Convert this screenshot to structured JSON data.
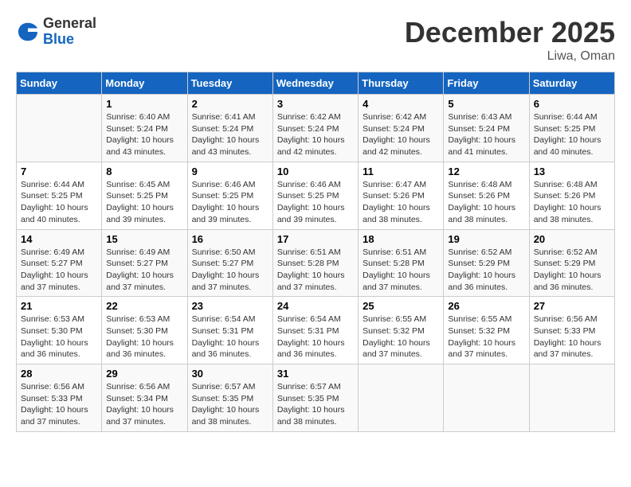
{
  "header": {
    "logo_general": "General",
    "logo_blue": "Blue",
    "month_title": "December 2025",
    "location": "Liwa, Oman"
  },
  "days_of_week": [
    "Sunday",
    "Monday",
    "Tuesday",
    "Wednesday",
    "Thursday",
    "Friday",
    "Saturday"
  ],
  "weeks": [
    [
      {
        "day": "",
        "sunrise": "",
        "sunset": "",
        "daylight": ""
      },
      {
        "day": "1",
        "sunrise": "Sunrise: 6:40 AM",
        "sunset": "Sunset: 5:24 PM",
        "daylight": "Daylight: 10 hours and 43 minutes."
      },
      {
        "day": "2",
        "sunrise": "Sunrise: 6:41 AM",
        "sunset": "Sunset: 5:24 PM",
        "daylight": "Daylight: 10 hours and 43 minutes."
      },
      {
        "day": "3",
        "sunrise": "Sunrise: 6:42 AM",
        "sunset": "Sunset: 5:24 PM",
        "daylight": "Daylight: 10 hours and 42 minutes."
      },
      {
        "day": "4",
        "sunrise": "Sunrise: 6:42 AM",
        "sunset": "Sunset: 5:24 PM",
        "daylight": "Daylight: 10 hours and 42 minutes."
      },
      {
        "day": "5",
        "sunrise": "Sunrise: 6:43 AM",
        "sunset": "Sunset: 5:24 PM",
        "daylight": "Daylight: 10 hours and 41 minutes."
      },
      {
        "day": "6",
        "sunrise": "Sunrise: 6:44 AM",
        "sunset": "Sunset: 5:25 PM",
        "daylight": "Daylight: 10 hours and 40 minutes."
      }
    ],
    [
      {
        "day": "7",
        "sunrise": "Sunrise: 6:44 AM",
        "sunset": "Sunset: 5:25 PM",
        "daylight": "Daylight: 10 hours and 40 minutes."
      },
      {
        "day": "8",
        "sunrise": "Sunrise: 6:45 AM",
        "sunset": "Sunset: 5:25 PM",
        "daylight": "Daylight: 10 hours and 39 minutes."
      },
      {
        "day": "9",
        "sunrise": "Sunrise: 6:46 AM",
        "sunset": "Sunset: 5:25 PM",
        "daylight": "Daylight: 10 hours and 39 minutes."
      },
      {
        "day": "10",
        "sunrise": "Sunrise: 6:46 AM",
        "sunset": "Sunset: 5:25 PM",
        "daylight": "Daylight: 10 hours and 39 minutes."
      },
      {
        "day": "11",
        "sunrise": "Sunrise: 6:47 AM",
        "sunset": "Sunset: 5:26 PM",
        "daylight": "Daylight: 10 hours and 38 minutes."
      },
      {
        "day": "12",
        "sunrise": "Sunrise: 6:48 AM",
        "sunset": "Sunset: 5:26 PM",
        "daylight": "Daylight: 10 hours and 38 minutes."
      },
      {
        "day": "13",
        "sunrise": "Sunrise: 6:48 AM",
        "sunset": "Sunset: 5:26 PM",
        "daylight": "Daylight: 10 hours and 38 minutes."
      }
    ],
    [
      {
        "day": "14",
        "sunrise": "Sunrise: 6:49 AM",
        "sunset": "Sunset: 5:27 PM",
        "daylight": "Daylight: 10 hours and 37 minutes."
      },
      {
        "day": "15",
        "sunrise": "Sunrise: 6:49 AM",
        "sunset": "Sunset: 5:27 PM",
        "daylight": "Daylight: 10 hours and 37 minutes."
      },
      {
        "day": "16",
        "sunrise": "Sunrise: 6:50 AM",
        "sunset": "Sunset: 5:27 PM",
        "daylight": "Daylight: 10 hours and 37 minutes."
      },
      {
        "day": "17",
        "sunrise": "Sunrise: 6:51 AM",
        "sunset": "Sunset: 5:28 PM",
        "daylight": "Daylight: 10 hours and 37 minutes."
      },
      {
        "day": "18",
        "sunrise": "Sunrise: 6:51 AM",
        "sunset": "Sunset: 5:28 PM",
        "daylight": "Daylight: 10 hours and 37 minutes."
      },
      {
        "day": "19",
        "sunrise": "Sunrise: 6:52 AM",
        "sunset": "Sunset: 5:29 PM",
        "daylight": "Daylight: 10 hours and 36 minutes."
      },
      {
        "day": "20",
        "sunrise": "Sunrise: 6:52 AM",
        "sunset": "Sunset: 5:29 PM",
        "daylight": "Daylight: 10 hours and 36 minutes."
      }
    ],
    [
      {
        "day": "21",
        "sunrise": "Sunrise: 6:53 AM",
        "sunset": "Sunset: 5:30 PM",
        "daylight": "Daylight: 10 hours and 36 minutes."
      },
      {
        "day": "22",
        "sunrise": "Sunrise: 6:53 AM",
        "sunset": "Sunset: 5:30 PM",
        "daylight": "Daylight: 10 hours and 36 minutes."
      },
      {
        "day": "23",
        "sunrise": "Sunrise: 6:54 AM",
        "sunset": "Sunset: 5:31 PM",
        "daylight": "Daylight: 10 hours and 36 minutes."
      },
      {
        "day": "24",
        "sunrise": "Sunrise: 6:54 AM",
        "sunset": "Sunset: 5:31 PM",
        "daylight": "Daylight: 10 hours and 36 minutes."
      },
      {
        "day": "25",
        "sunrise": "Sunrise: 6:55 AM",
        "sunset": "Sunset: 5:32 PM",
        "daylight": "Daylight: 10 hours and 37 minutes."
      },
      {
        "day": "26",
        "sunrise": "Sunrise: 6:55 AM",
        "sunset": "Sunset: 5:32 PM",
        "daylight": "Daylight: 10 hours and 37 minutes."
      },
      {
        "day": "27",
        "sunrise": "Sunrise: 6:56 AM",
        "sunset": "Sunset: 5:33 PM",
        "daylight": "Daylight: 10 hours and 37 minutes."
      }
    ],
    [
      {
        "day": "28",
        "sunrise": "Sunrise: 6:56 AM",
        "sunset": "Sunset: 5:33 PM",
        "daylight": "Daylight: 10 hours and 37 minutes."
      },
      {
        "day": "29",
        "sunrise": "Sunrise: 6:56 AM",
        "sunset": "Sunset: 5:34 PM",
        "daylight": "Daylight: 10 hours and 37 minutes."
      },
      {
        "day": "30",
        "sunrise": "Sunrise: 6:57 AM",
        "sunset": "Sunset: 5:35 PM",
        "daylight": "Daylight: 10 hours and 38 minutes."
      },
      {
        "day": "31",
        "sunrise": "Sunrise: 6:57 AM",
        "sunset": "Sunset: 5:35 PM",
        "daylight": "Daylight: 10 hours and 38 minutes."
      },
      {
        "day": "",
        "sunrise": "",
        "sunset": "",
        "daylight": ""
      },
      {
        "day": "",
        "sunrise": "",
        "sunset": "",
        "daylight": ""
      },
      {
        "day": "",
        "sunrise": "",
        "sunset": "",
        "daylight": ""
      }
    ]
  ]
}
